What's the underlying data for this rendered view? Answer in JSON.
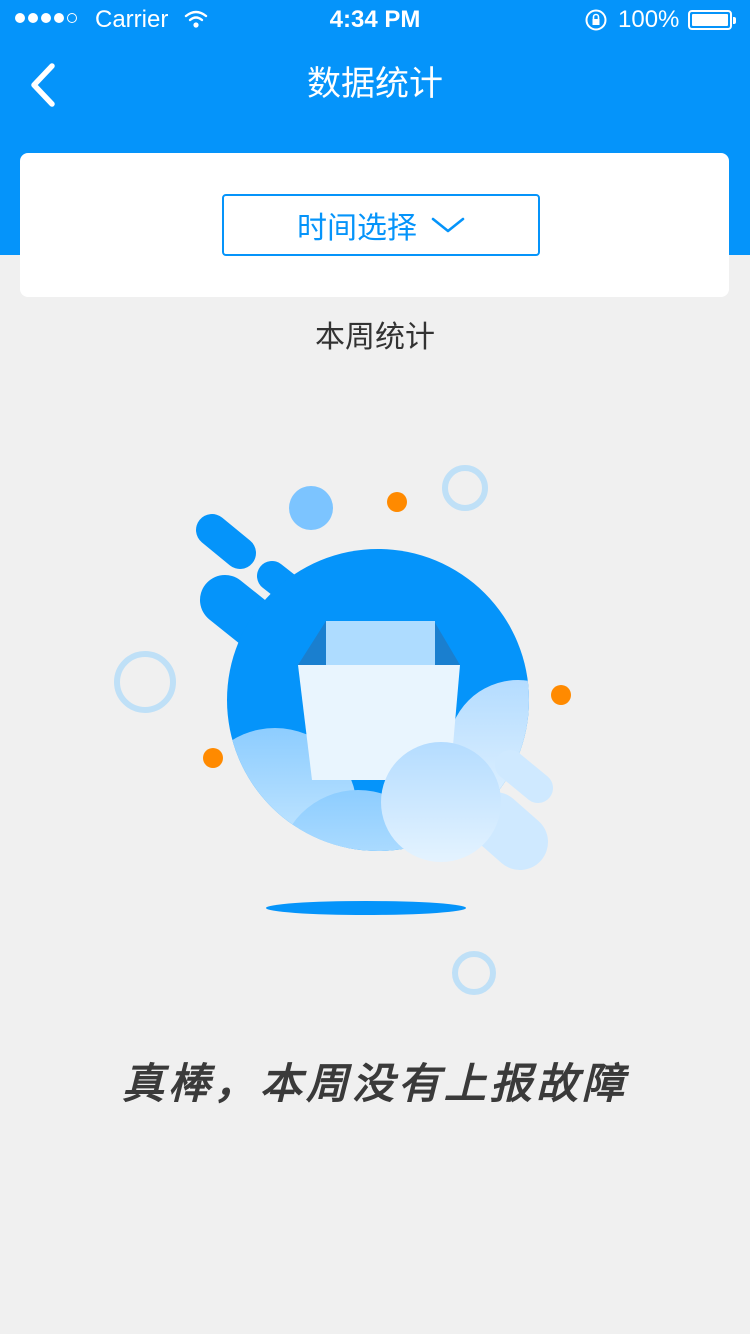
{
  "status_bar": {
    "carrier": "Carrier",
    "time": "4:34 PM",
    "battery": "100%"
  },
  "nav": {
    "title": "数据统计",
    "back_icon": "chevron-left-icon"
  },
  "filter": {
    "time_select_label": "时间选择",
    "dropdown_icon": "chevron-down-icon"
  },
  "section": {
    "title": "本周统计"
  },
  "empty_state": {
    "message": "真棒，本周没有上报故障",
    "illustration": "empty-box-icon"
  },
  "colors": {
    "primary": "#0594fa",
    "background": "#f0f0f0",
    "accent_orange": "#ff8a00",
    "light_blue": "#7cc4ff"
  }
}
